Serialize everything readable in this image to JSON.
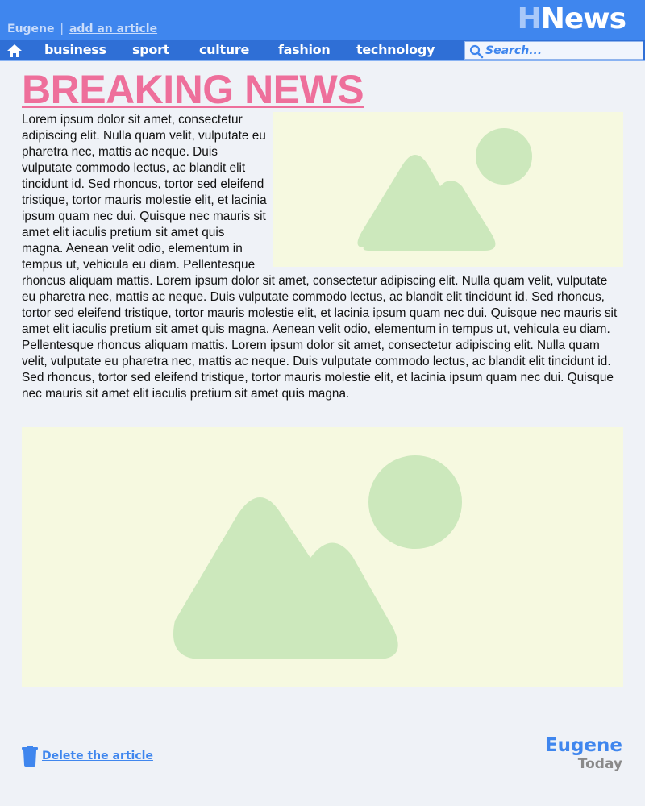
{
  "header": {
    "username": "Eugene",
    "separator": "|",
    "add_article": "add an article",
    "logo_prefix": "H",
    "logo_rest": "News"
  },
  "nav": {
    "items": [
      "business",
      "sport",
      "culture",
      "fashion",
      "technology"
    ],
    "search_placeholder": "Search..."
  },
  "article": {
    "title": "BREAKING NEWS",
    "paragraph": "Lorem ipsum dolor sit amet, consectetur adipiscing elit. Nulla quam velit, vulputate eu pharetra nec, mattis ac neque. Duis vulputate commodo lectus, ac blandit elit tincidunt id. Sed rhoncus, tortor sed eleifend tristique, tortor mauris molestie elit, et lacinia ipsum quam nec dui. Quisque nec mauris sit amet elit iaculis pretium sit amet quis magna. Aenean velit odio, elementum in tempus ut, vehicula eu diam. Pellentesque rhoncus aliquam mattis. Lorem ipsum dolor sit amet, consectetur adipiscing elit. Nulla quam velit, vulputate eu pharetra nec, mattis ac neque. Duis vulputate commodo lectus, ac blandit elit tincidunt id. Sed rhoncus, tortor sed eleifend tristique, tortor mauris molestie elit, et lacinia ipsum quam nec dui. Quisque nec mauris sit amet elit iaculis pretium sit amet quis magna. Aenean velit odio, elementum in tempus ut, vehicula eu diam. Pellentesque rhoncus aliquam mattis.  Lorem ipsum dolor sit amet, consectetur adipiscing elit. Nulla quam velit, vulputate eu pharetra nec, mattis ac neque. Duis vulputate commodo lectus, ac blandit elit tincidunt id. Sed rhoncus, tortor sed eleifend tristique, tortor mauris molestie elit, et lacinia ipsum quam nec dui. Quisque nec mauris sit amet elit iaculis pretium sit amet quis magna.",
    "image_icon": "image-placeholder-icon"
  },
  "footer": {
    "delete_label": "Delete the article",
    "delete_icon": "trash-icon",
    "brand_line1": "Eugene",
    "brand_line2": "Today"
  },
  "colors": {
    "header_blue": "#3f86ee",
    "nav_blue": "#2f6fd6",
    "headline_pink": "#ee6f9b",
    "image_bg": "#f6f9e0",
    "image_shape": "#cce8bc"
  }
}
